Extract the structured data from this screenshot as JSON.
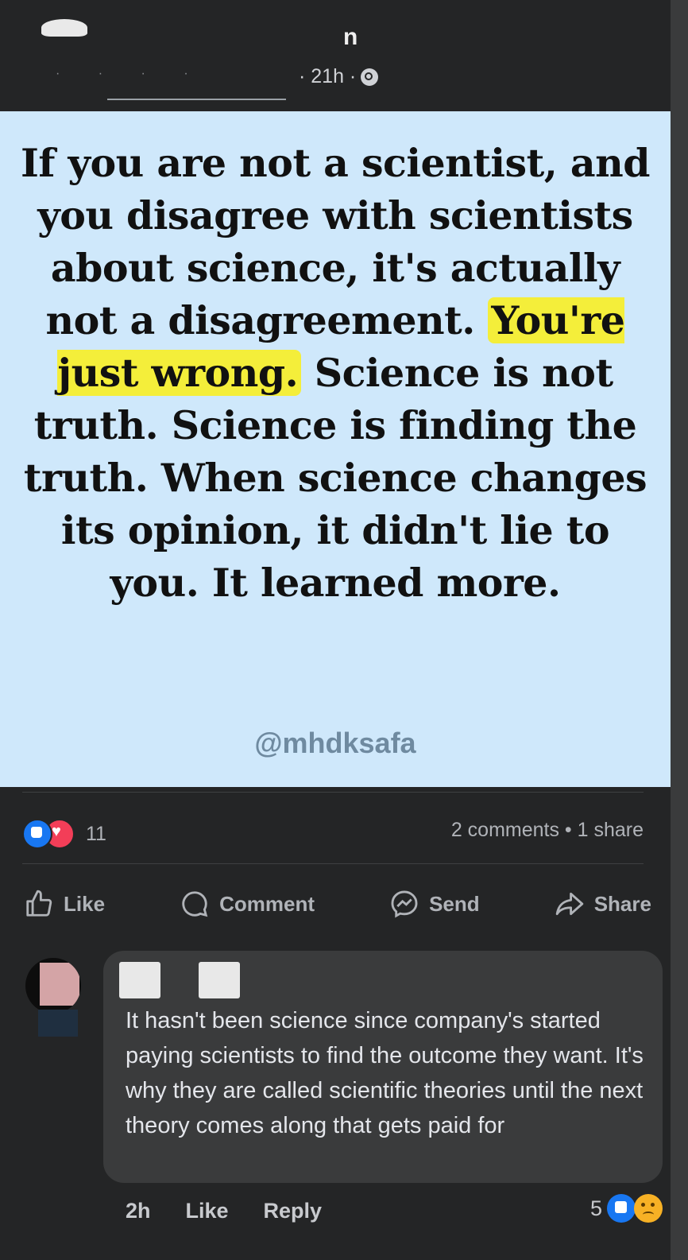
{
  "post": {
    "author_initial": "n",
    "time": "· 21h ·",
    "image": {
      "quote_parts": [
        "If you are not a scientist, and you disagree with scientists about science, it's actually not a disagreement. ",
        "You're just wrong.",
        " Science is not truth. Science is finding the truth. When science changes its opinion, it didn't lie to you. It learned more."
      ],
      "watermark": "@mhdksafa"
    },
    "reaction_count": "11",
    "stats": "2 comments • 1 share",
    "actions": {
      "like": "Like",
      "comment": "Comment",
      "send": "Send",
      "share": "Share"
    }
  },
  "comment": {
    "text": "It hasn't been science since company's started paying scientists to find the outcome they want. It's why they are called scientific theories until the next theory comes along that gets paid for",
    "time": "2h",
    "like": "Like",
    "reply": "Reply",
    "reaction_count": "5"
  },
  "colors": {
    "background": "#242526",
    "image_bg": "#cfe8fb",
    "highlight": "#f4ee3a",
    "like_blue": "#1877f2",
    "love_red": "#f33e58"
  }
}
